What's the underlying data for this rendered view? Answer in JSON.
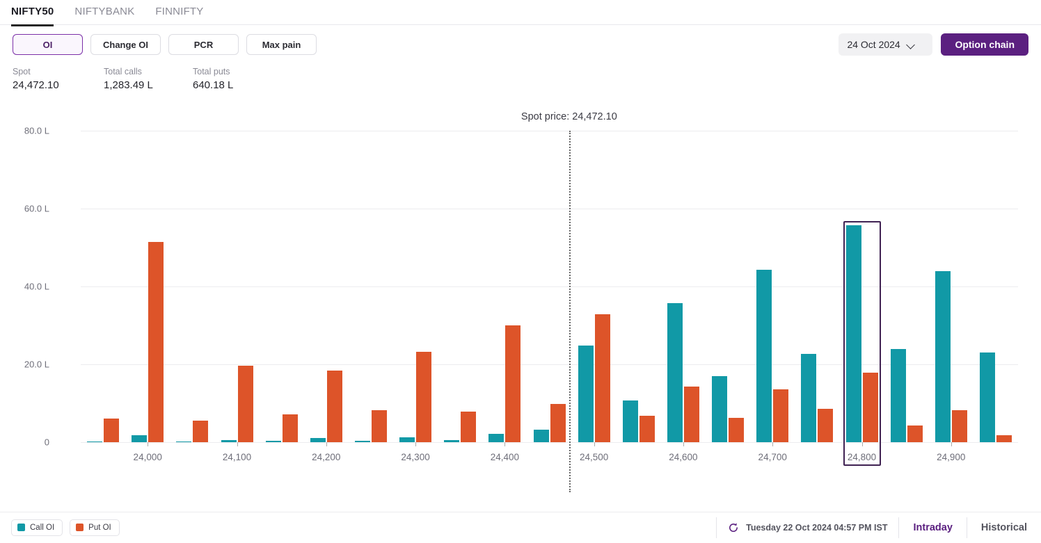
{
  "tabs": [
    {
      "label": "NIFTY50",
      "active": true
    },
    {
      "label": "NIFTYBANK",
      "active": false
    },
    {
      "label": "FINNIFTY",
      "active": false
    }
  ],
  "toolbar": {
    "buttons": [
      {
        "label": "OI",
        "active": true
      },
      {
        "label": "Change OI",
        "active": false
      },
      {
        "label": "PCR",
        "active": false
      },
      {
        "label": "Max pain",
        "active": false
      }
    ],
    "date_value": "24 Oct 2024",
    "date_icon": "chevron-down-icon",
    "option_chain_label": "Option chain"
  },
  "stats": [
    {
      "label": "Spot",
      "value": "24,472.10"
    },
    {
      "label": "Total calls",
      "value": "1,283.49 L"
    },
    {
      "label": "Total puts",
      "value": "640.18 L"
    }
  ],
  "legend": [
    {
      "label": "Call OI",
      "color": "#1199a6",
      "swatch": "call-oi-swatch"
    },
    {
      "label": "Put OI",
      "color": "#dd5429",
      "swatch": "put-oi-swatch"
    }
  ],
  "footer": {
    "refresh_icon": "refresh-icon",
    "timestamp": "Tuesday 22 Oct 2024 04:57 PM IST",
    "modes": [
      {
        "label": "Intraday",
        "active": true
      },
      {
        "label": "Historical",
        "active": false
      }
    ]
  },
  "colors": {
    "call": "#1199a6",
    "put": "#dd5429",
    "accent": "#5b2080",
    "highlight_border": "#3f2152",
    "grid": "#ececef",
    "spot_line": "#666666"
  },
  "chart_data": {
    "type": "bar",
    "title": "",
    "xlabel": "",
    "ylabel": "",
    "ylim": [
      0,
      80
    ],
    "yticks": [
      "0",
      "20.0 L",
      "40.0 L",
      "60.0 L",
      "80.0 L"
    ],
    "ytick_values": [
      0,
      20,
      40,
      60,
      80
    ],
    "grid": true,
    "legend_position": "bottom-left",
    "unit": "L",
    "spot_price": 24472.1,
    "spot_label": "Spot price: 24,472.10",
    "highlighted_category": "24,800",
    "xtick_labels": [
      "24,000",
      "24,100",
      "24,200",
      "24,300",
      "24,400",
      "24,500",
      "24,600",
      "24,700",
      "24,800",
      "24,900"
    ],
    "categories": [
      "23,950",
      "24,000",
      "24,050",
      "24,100",
      "24,150",
      "24,200",
      "24,250",
      "24,300",
      "24,350",
      "24,400",
      "24,450",
      "24,500",
      "24,550",
      "24,600",
      "24,650",
      "24,700",
      "24,750",
      "24,800",
      "24,850",
      "24,900",
      "24,950"
    ],
    "series": [
      {
        "name": "Call OI",
        "color": "#1199a6",
        "values": [
          0.2,
          1.8,
          0.2,
          0.5,
          0.3,
          1.1,
          0.4,
          1.3,
          0.6,
          2.1,
          3.3,
          24.8,
          10.7,
          35.8,
          16.9,
          44.2,
          22.6,
          55.7,
          23.9,
          44.0,
          23.0
        ]
      },
      {
        "name": "Put OI",
        "color": "#dd5429",
        "values": [
          6.0,
          51.5,
          5.6,
          19.6,
          7.2,
          18.4,
          8.3,
          23.2,
          7.8,
          30.0,
          9.8,
          32.8,
          6.7,
          14.3,
          6.2,
          13.5,
          8.6,
          17.9,
          4.3,
          8.3,
          1.7
        ]
      }
    ]
  }
}
